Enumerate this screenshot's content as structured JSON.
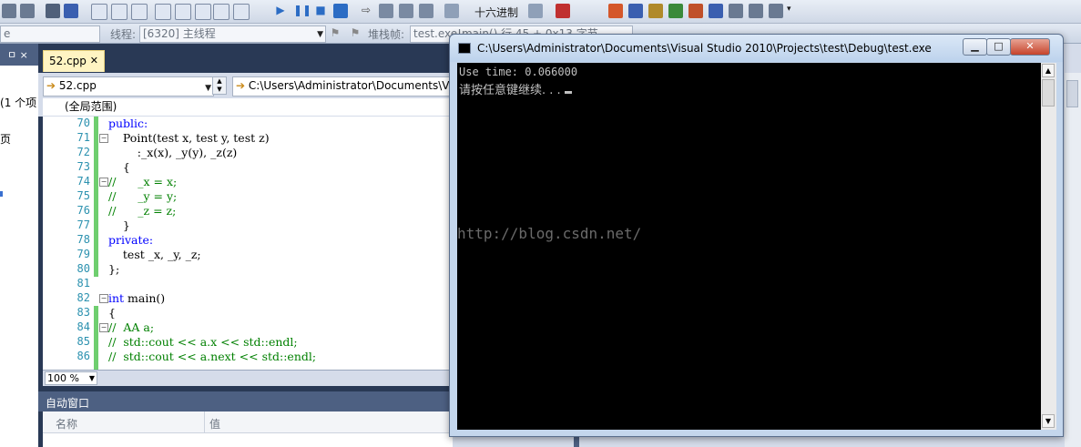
{
  "toolbar1": {
    "hex_label": "十六进制"
  },
  "toolbar2": {
    "search_partial": "e",
    "thread_label": "线程:",
    "thread_value": "[6320] 主线程",
    "stack_label": "堆栈帧:",
    "stack_value": "test.exe!main()  行 45 + 0x13 字节"
  },
  "left_panel": {
    "pin": "ㅁ ×",
    "item_count": "1 个项",
    "item2": "页"
  },
  "editor": {
    "tab_label": "52.cpp",
    "file_combo": "52.cpp",
    "path_combo": "C:\\Users\\Administrator\\Documents\\V",
    "scope": "(全局范围)",
    "zoom": "100 %",
    "lines": [
      {
        "n": "70",
        "t": "public:"
      },
      {
        "n": "71",
        "t": "    Point(test x, test y, test z)"
      },
      {
        "n": "72",
        "t": "        :_x(x), _y(y), _z(z)"
      },
      {
        "n": "73",
        "t": "    {"
      },
      {
        "n": "74",
        "t": "//      _x = x;"
      },
      {
        "n": "75",
        "t": "//      _y = y;"
      },
      {
        "n": "76",
        "t": "//      _z = z;"
      },
      {
        "n": "77",
        "t": "    }"
      },
      {
        "n": "78",
        "t": "private:"
      },
      {
        "n": "79",
        "t": "    test _x, _y, _z;"
      },
      {
        "n": "80",
        "t": "};"
      },
      {
        "n": "81",
        "t": ""
      },
      {
        "n": "82",
        "t": "int main()"
      },
      {
        "n": "83",
        "t": "{"
      },
      {
        "n": "84",
        "t": "//  AA a;"
      },
      {
        "n": "85",
        "t": "//  std::cout << a.x << std::endl;"
      },
      {
        "n": "86",
        "t": "//  std::cout << a.next << std::endl;"
      }
    ]
  },
  "auto_window": {
    "title": "自动窗口",
    "col_name": "名称",
    "col_value": "值"
  },
  "console": {
    "title": "C:\\Users\\Administrator\\Documents\\Visual Studio 2010\\Projects\\test\\Debug\\test.exe",
    "line1": "Use time: 0.066000",
    "line2": "请按任意键继续. . . ",
    "watermark": "http://blog.csdn.net/"
  }
}
